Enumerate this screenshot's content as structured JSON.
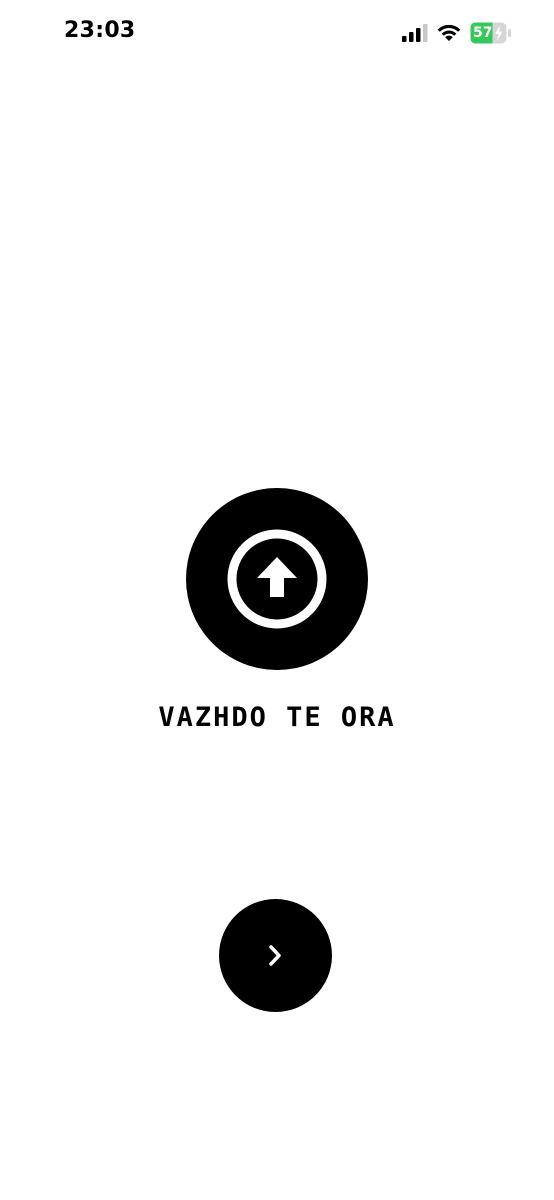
{
  "status_bar": {
    "time": "23:03",
    "battery_level": "57",
    "icons": [
      "signal-icon",
      "wifi-icon",
      "battery-charging-icon"
    ],
    "battery_color": "#34c759"
  },
  "main": {
    "title": "VAZHDO TE ORA",
    "upload_icon": "arrow-up-circle-icon",
    "next_icon": "chevron-right-icon"
  },
  "colors": {
    "background": "#ffffff",
    "primary": "#000000",
    "icon": "#ffffff"
  }
}
